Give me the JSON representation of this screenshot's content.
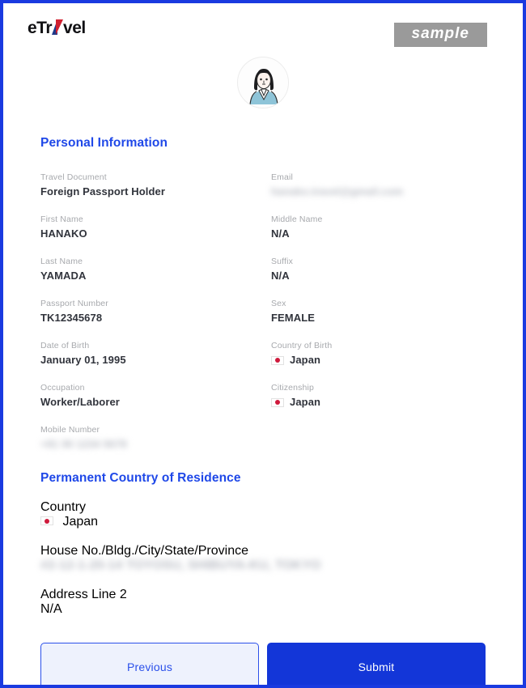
{
  "brand": {
    "logo_pre": "eTr",
    "logo_post": "vel",
    "plane_blue": "#1e3a8a",
    "plane_red": "#d02030"
  },
  "badge": {
    "label": "sample",
    "bg": "#9a9a9a"
  },
  "avatar": {
    "icon": "user-avatar-illustration",
    "alt": "Applicant avatar"
  },
  "colors": {
    "accent": "#1f48e8",
    "submit_bg": "#1336d8",
    "previous_bg": "#eef2fd",
    "frame_border": "#1a3ae0",
    "label": "#a7a9ad",
    "value": "#31343c"
  },
  "personal_information": {
    "title": "Personal Information",
    "fields": [
      {
        "label": "Travel Document",
        "value": "Foreign Passport Holder",
        "blurred": false,
        "flag": false
      },
      {
        "label": "Email",
        "value": "hanako.travel@gmail.com",
        "blurred": true,
        "flag": false
      },
      {
        "label": "First Name",
        "value": "HANAKO",
        "blurred": false,
        "flag": false
      },
      {
        "label": "Middle Name",
        "value": "N/A",
        "blurred": false,
        "flag": false
      },
      {
        "label": "Last Name",
        "value": "YAMADA",
        "blurred": false,
        "flag": false
      },
      {
        "label": "Suffix",
        "value": "N/A",
        "blurred": false,
        "flag": false
      },
      {
        "label": "Passport Number",
        "value": "TK12345678",
        "blurred": false,
        "flag": false
      },
      {
        "label": "Sex",
        "value": "FEMALE",
        "blurred": false,
        "flag": false
      },
      {
        "label": "Date of Birth",
        "value": "January 01, 1995",
        "blurred": false,
        "flag": false
      },
      {
        "label": "Country of Birth",
        "value": "Japan",
        "blurred": false,
        "flag": true
      },
      {
        "label": "Occupation",
        "value": "Worker/Laborer",
        "blurred": false,
        "flag": false
      },
      {
        "label": "Citizenship",
        "value": "Japan",
        "blurred": false,
        "flag": true
      },
      {
        "label": "Mobile Number",
        "value": "+81 90 1234 5678",
        "blurred": true,
        "flag": false
      }
    ]
  },
  "permanent_country_of_residence": {
    "title": "Permanent Country of Residence",
    "fields": [
      {
        "label": "Country",
        "value": "Japan",
        "blurred": false,
        "flag": true
      },
      {
        "label": "House No./Bldg./City/State/Province",
        "value": "#2-12-1-20-14 TOYOSU, SHIBUYA-KU, TOKYO",
        "blurred": true,
        "flag": false
      },
      {
        "label": "Address Line 2",
        "value": "N/A",
        "blurred": false,
        "flag": false
      }
    ]
  },
  "buttons": {
    "previous_label": "Previous",
    "submit_label": "Submit"
  }
}
